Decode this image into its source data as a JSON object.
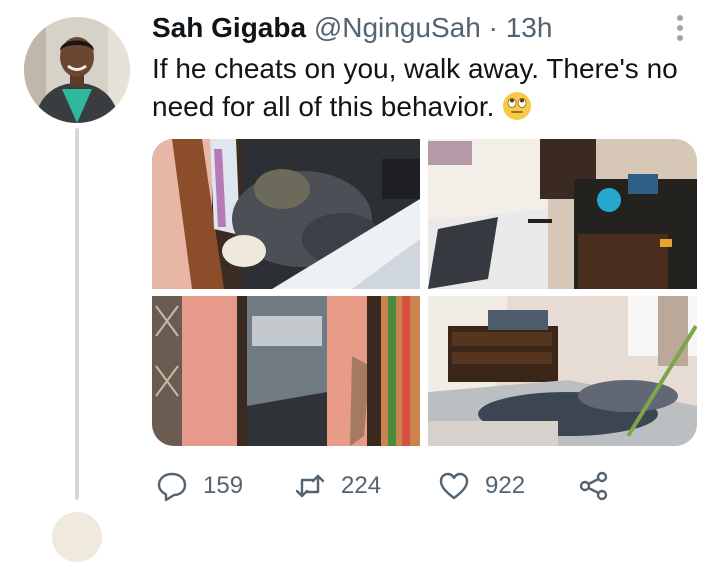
{
  "tweet": {
    "author_name": "Sah Gigaba",
    "author_handle": "@NginguSah",
    "separator": "·",
    "time": "13h",
    "text": "If he cheats on you, walk away. There's no need for all of this behavior.",
    "emoji": "face-with-rolling-eyes-emoji",
    "media": {
      "count": 4,
      "photos": [
        {
          "description_icon": "photo-messy-wardrobe"
        },
        {
          "description_icon": "photo-broken-furniture"
        },
        {
          "description_icon": "photo-damaged-door"
        },
        {
          "description_icon": "photo-trashed-bedroom"
        }
      ]
    },
    "actions": {
      "replies": "159",
      "retweets": "224",
      "likes": "922"
    }
  },
  "colors": {
    "text_primary": "#0f1419",
    "text_secondary": "#536471",
    "thread_line": "#cfd9de",
    "icon": "#536471"
  }
}
